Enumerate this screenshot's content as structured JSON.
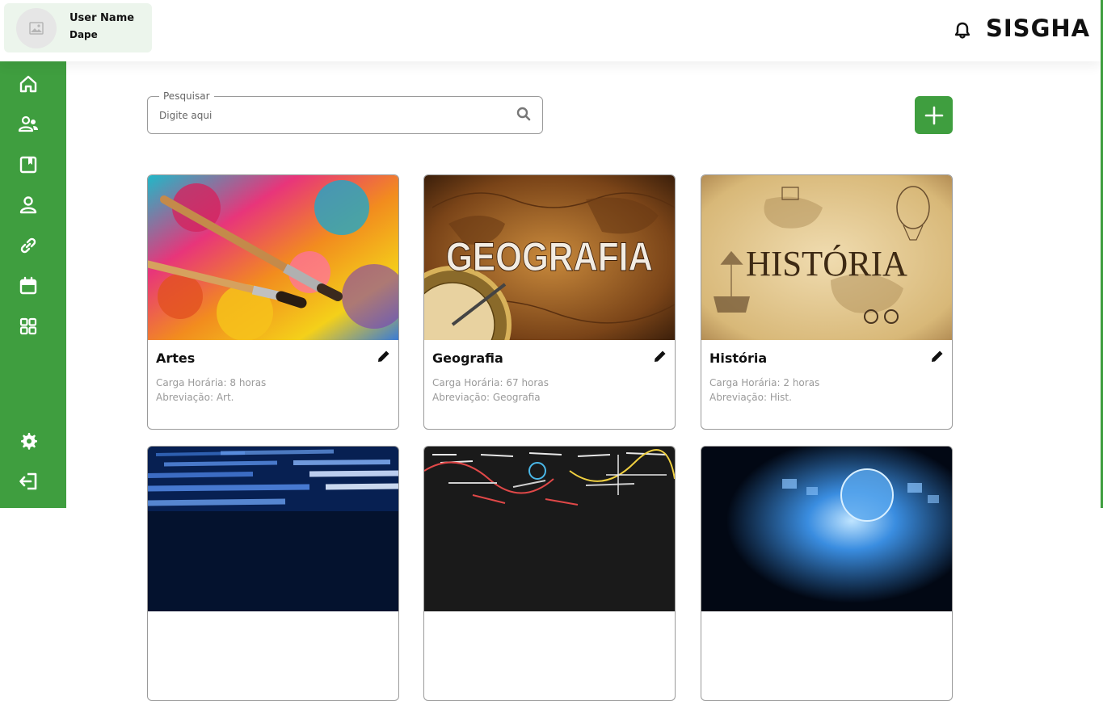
{
  "user": {
    "name": "User Name",
    "role": "Dape"
  },
  "brand": "SISGHA",
  "colors": {
    "accent": "#3f9e3f",
    "border": "#9a9a9a",
    "muted": "#9a9a9a"
  },
  "sidebar": {
    "items": [
      {
        "icon": "home-icon"
      },
      {
        "icon": "users-icon"
      },
      {
        "icon": "book-icon"
      },
      {
        "icon": "person-icon"
      },
      {
        "icon": "link-icon"
      },
      {
        "icon": "calendar-icon"
      },
      {
        "icon": "grid-icon"
      },
      {
        "icon": "gear-icon"
      },
      {
        "icon": "logout-icon"
      }
    ]
  },
  "search": {
    "label": "Pesquisar",
    "placeholder": "Digite aqui",
    "value": ""
  },
  "cards": [
    {
      "title": "Artes",
      "hours": "Carga Horária: 8 horas",
      "abbr": "Abreviação: Art."
    },
    {
      "title": "Geografia",
      "hours": "Carga Horária: 67 horas",
      "abbr": "Abreviação: Geografia",
      "image_text": "GEOGRAFIA"
    },
    {
      "title": "História",
      "hours": "Carga Horária: 2 horas",
      "abbr": "Abreviação: Hist.",
      "image_text": "HISTÓRIA"
    },
    {
      "title": "",
      "hours": "",
      "abbr": ""
    },
    {
      "title": "",
      "hours": "",
      "abbr": ""
    },
    {
      "title": "",
      "hours": "",
      "abbr": ""
    }
  ]
}
